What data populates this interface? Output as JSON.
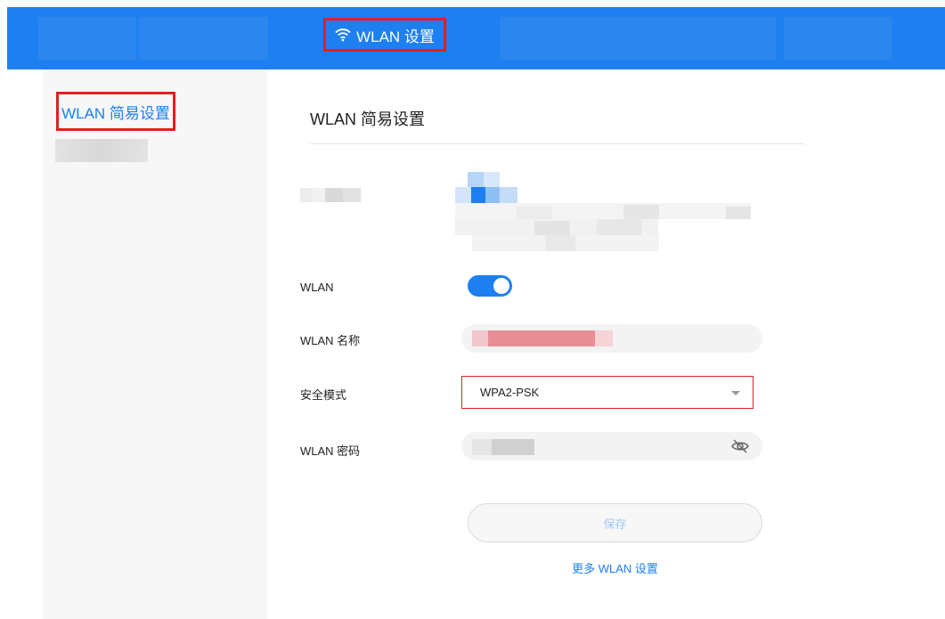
{
  "header": {
    "active_tab_label": "WLAN 设置",
    "background_color": "#1e7ff0"
  },
  "sidebar": {
    "active_item_label": "WLAN 简易设置"
  },
  "main": {
    "title": "WLAN 简易设置",
    "fields": {
      "wlan_label": "WLAN",
      "wlan_enabled": true,
      "name_label": "WLAN 名称",
      "security_label": "安全模式",
      "security_value": "WPA2-PSK",
      "password_label": "WLAN 密码"
    },
    "save_label": "保存",
    "more_link": "更多 WLAN 设置"
  },
  "icons": {
    "wifi": "wifi-icon",
    "eye": "eye-off-icon",
    "caret": "chevron-down-icon"
  },
  "colors": {
    "accent": "#1e7ff0",
    "highlight_border": "#e02020"
  }
}
